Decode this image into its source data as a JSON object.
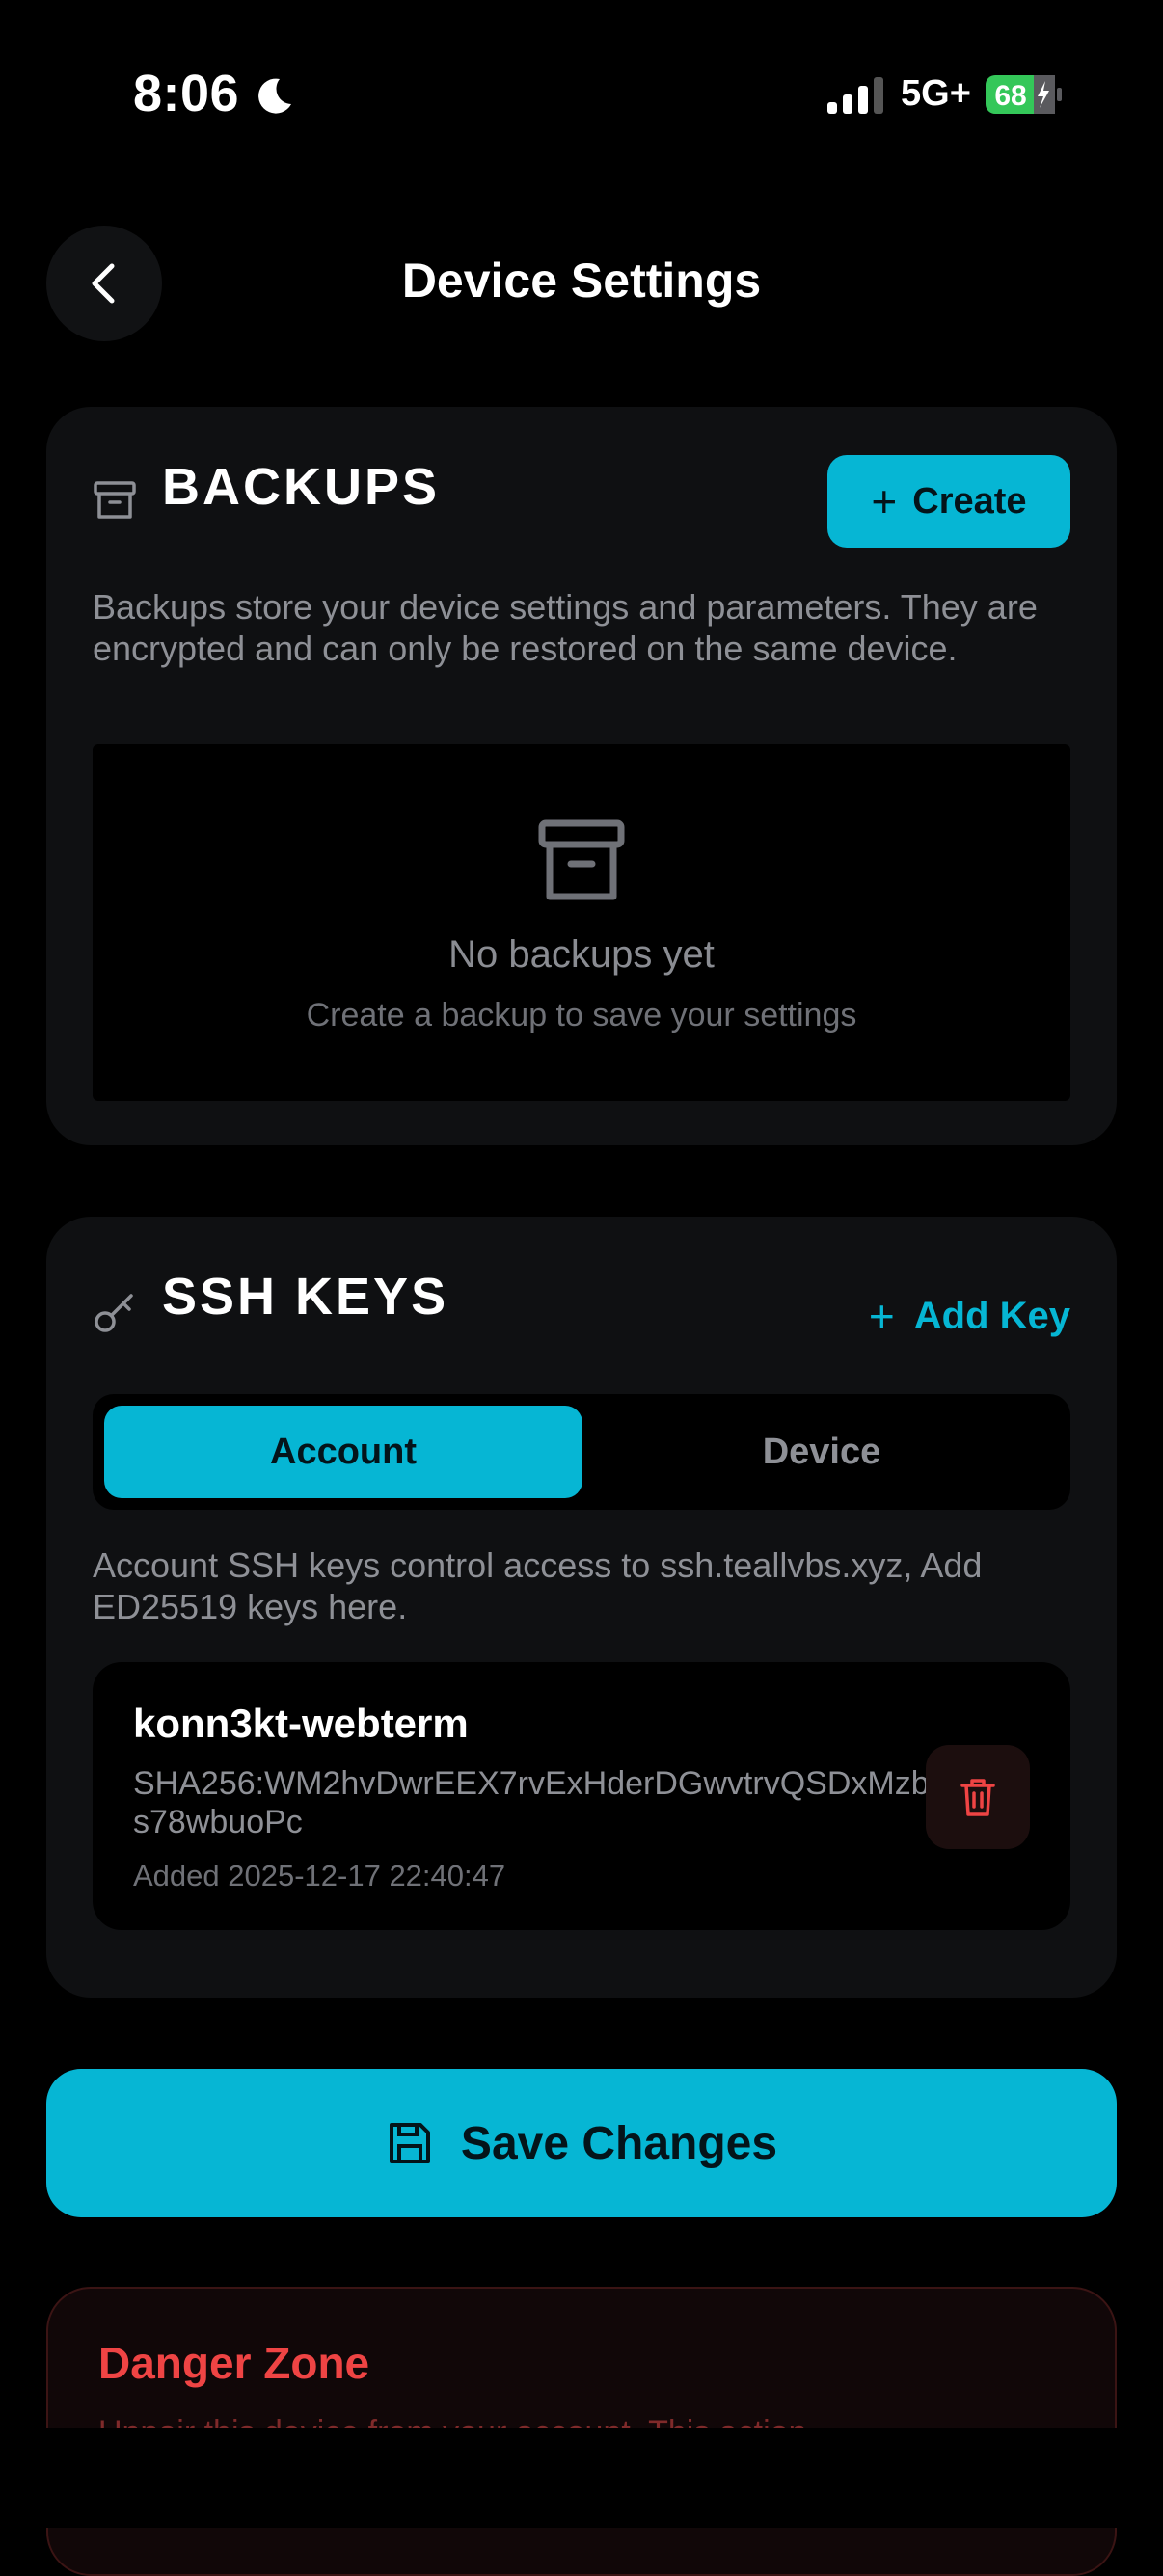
{
  "status_bar": {
    "time": "8:06",
    "network": "5G+",
    "battery": "68"
  },
  "header": {
    "title": "Device Settings"
  },
  "backups": {
    "title": "BACKUPS",
    "create_label": "Create",
    "description": "Backups store your device settings and parameters. They are encrypted and can only be restored on the same device.",
    "empty_title": "No backups yet",
    "empty_subtitle": "Create a backup to save your settings"
  },
  "ssh_keys": {
    "title": "SSH KEYS",
    "add_label": "Add Key",
    "tabs": [
      {
        "label": "Account",
        "active": true
      },
      {
        "label": "Device",
        "active": false
      }
    ],
    "description": "Account SSH keys control access to ssh.teallvbs.xyz, Add ED25519 keys here.",
    "keys": [
      {
        "name": "konn3kt-webterm",
        "fingerprint": "SHA256:WM2hvDwrEEX7rvExHderDGwvtrvQSDxMzbs78wbuoPc",
        "added": "Added 2025-12-17 22:40:47"
      }
    ]
  },
  "save": {
    "label": "Save Changes"
  },
  "danger_zone": {
    "title": "Danger Zone",
    "text": "Unpair this device from your account. This action"
  },
  "colors": {
    "accent": "#06b6d4",
    "danger": "#ef4444",
    "battery": "#34c759"
  }
}
